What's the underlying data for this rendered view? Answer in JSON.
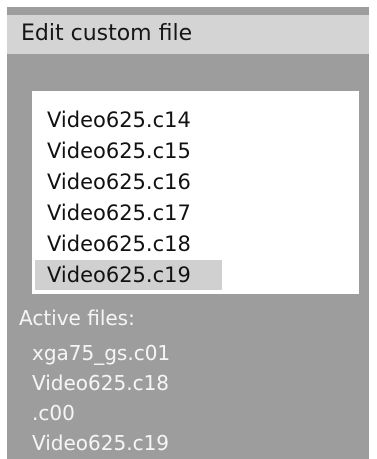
{
  "header": {
    "title": "Edit custom file"
  },
  "file_list": {
    "items": [
      {
        "label": "Video625.c14",
        "selected": false
      },
      {
        "label": "Video625.c15",
        "selected": false
      },
      {
        "label": "Video625.c16",
        "selected": false
      },
      {
        "label": "Video625.c17",
        "selected": false
      },
      {
        "label": "Video625.c18",
        "selected": false
      },
      {
        "label": "Video625.c19",
        "selected": true
      }
    ]
  },
  "active_files": {
    "label": "Active files:",
    "items": [
      "xga75_gs.c01",
      "Video625.c18",
      ".c00",
      "Video625.c19"
    ]
  },
  "colors": {
    "panel_background": "#9d9d9d",
    "title_bar_background": "#d4d4d4",
    "list_background": "#ffffff",
    "selection_highlight": "#d0d0d0",
    "active_text": "#f5f5f5"
  }
}
